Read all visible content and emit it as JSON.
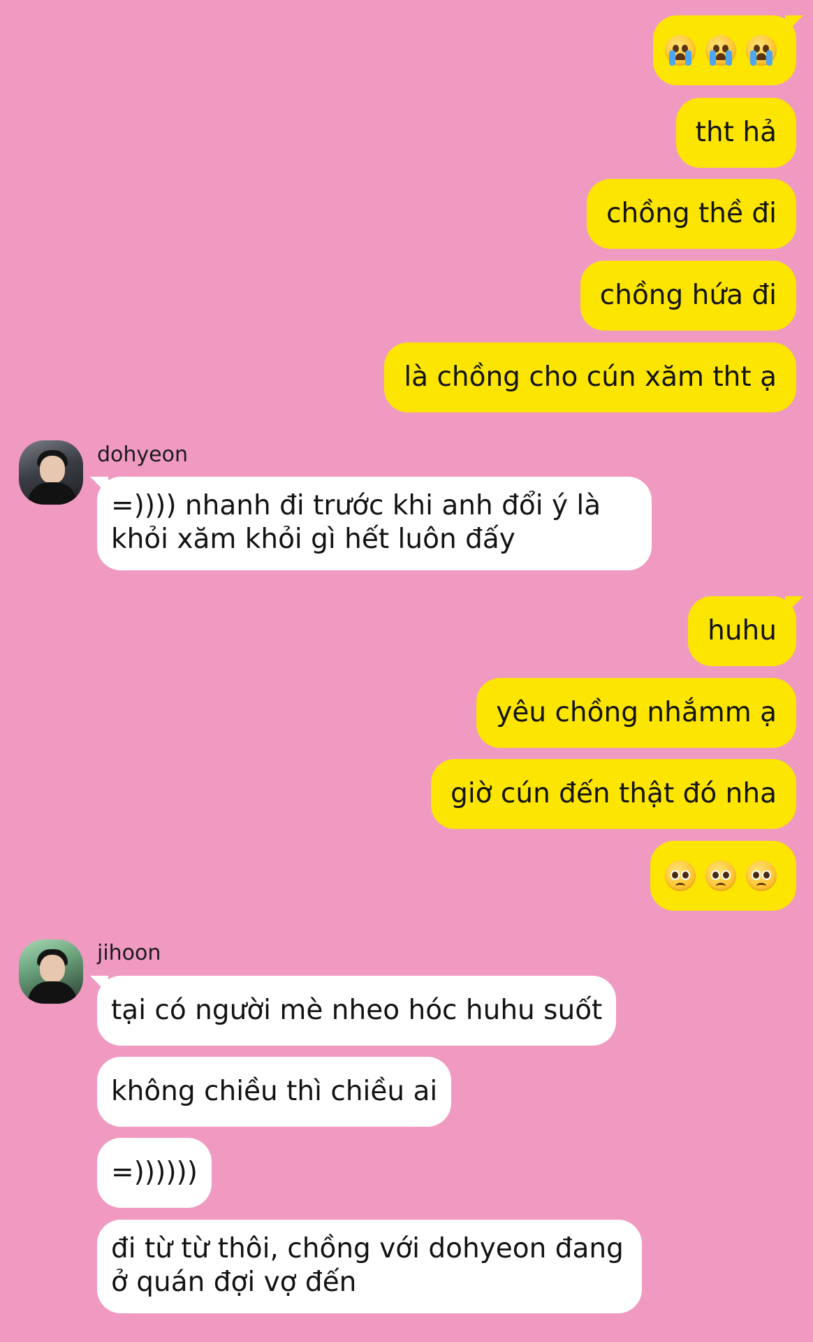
{
  "theme": {
    "background": "#F09AC2",
    "outgoing_bubble": "#FCE500",
    "incoming_bubble": "#FFFFFF"
  },
  "messages": {
    "m1": {
      "emoji": [
        "loudly-crying-face",
        "loudly-crying-face",
        "loudly-crying-face"
      ]
    },
    "m2": {
      "text": "tht hả"
    },
    "m3": {
      "text": "chồng thề đi"
    },
    "m4": {
      "text": "chồng hứa đi"
    },
    "m5": {
      "text": "là chồng cho cún xăm tht ạ"
    },
    "dohyeon": {
      "sender": "dohyeon",
      "text": "=)))) nhanh đi trước khi anh đổi ý là khỏi xăm khỏi gì hết luôn đấy"
    },
    "m6": {
      "text": "huhu"
    },
    "m7": {
      "text": "yêu chồng nhắmm ạ"
    },
    "m8": {
      "text": "giờ cún đến thật đó nha"
    },
    "m9": {
      "emoji": [
        "pleading-face",
        "pleading-face",
        "pleading-face"
      ]
    },
    "jihoon": {
      "sender": "jihoon",
      "texts": [
        "tại có người mè nheo hóc huhu suốt",
        "không chiều thì chiều ai",
        "=))))))",
        "đi từ từ thôi, chồng với dohyeon đang ở quán đợi vợ đến"
      ]
    }
  }
}
